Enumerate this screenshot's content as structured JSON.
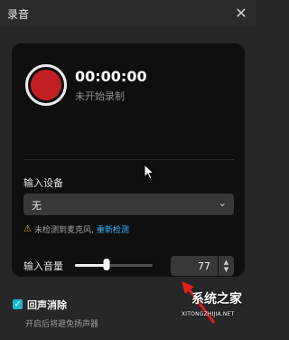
{
  "window": {
    "title": "录音",
    "close_icon": "close-icon"
  },
  "recorder": {
    "time": "00:00:00",
    "status": "未开始录制",
    "record_color": "#c11f23"
  },
  "input_device": {
    "label": "输入设备",
    "selected": "无",
    "warning_text": "未检测到麦克风,",
    "redetect_link": "重新检测",
    "link_color": "#36b7ff"
  },
  "input_volume": {
    "label": "输入音量",
    "value": "77",
    "level_fraction": 0.41
  },
  "echo_cancel": {
    "label": "回声消除",
    "checked": true,
    "description": "开启后将避免扬声器",
    "checkbox_color": "#20b8c8"
  },
  "watermark": {
    "line1": "系统之家",
    "line2": "XITONGZHIJIA.NET"
  }
}
